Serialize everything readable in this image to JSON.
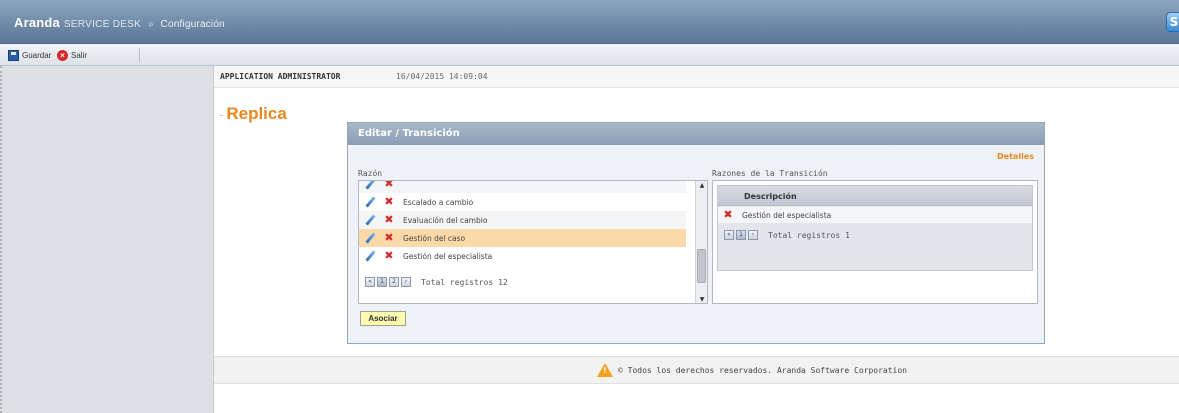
{
  "titlebar": {
    "brand": "Aranda",
    "product": "SERVICE DESK",
    "separator": "»",
    "section": "Configuración"
  },
  "toolbar": {
    "save_label": "Guardar",
    "exit_label": "Salir"
  },
  "user": {
    "name": "APPLICATION ADMINISTRATOR",
    "datetime": "16/04/2015 14:09:04"
  },
  "page": {
    "title": "Replica"
  },
  "editor": {
    "title": "Editar / Transición",
    "details_link": "Detalles",
    "reason_label": "Razón",
    "transition_label": "Razones de la Transición",
    "reasons": [
      {
        "label": "Escalado a cambio"
      },
      {
        "label": "Evaluación del cambio"
      },
      {
        "label": "Gestión del caso"
      },
      {
        "label": "Gestión del especialista"
      }
    ],
    "selected_index": 2,
    "reason_pager": {
      "pages": [
        "1",
        "2"
      ],
      "total": "Total registros 12"
    },
    "associate_button": "Asociar",
    "transition_table": {
      "header": "Descripción",
      "rows": [
        {
          "label": "Gestión del especialista"
        }
      ],
      "pager": {
        "pages": [
          "1"
        ],
        "total": "Total registros 1"
      }
    }
  },
  "footer": {
    "text": "© Todos los derechos reservados. Aranda Software Corporation"
  }
}
